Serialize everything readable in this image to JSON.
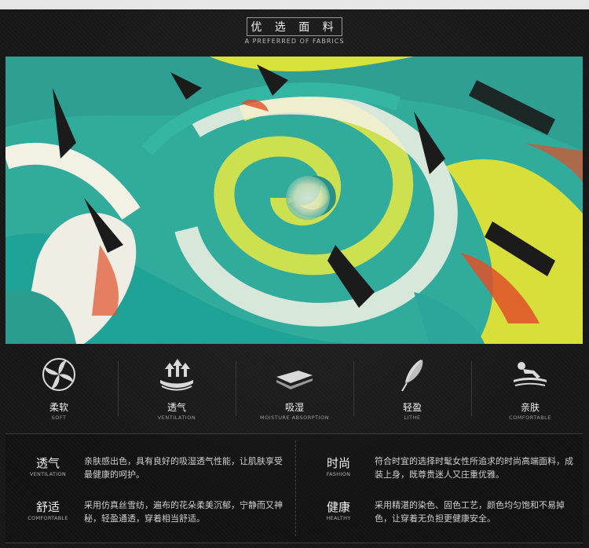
{
  "header": {
    "title": "优 选 面 料",
    "subtitle": "A PREFERRED OF FABRICS"
  },
  "photo": {
    "alt_colors": [
      "#2aa79a",
      "#d8e13a",
      "#f2f0e6",
      "#1a1a1a",
      "#e0502a"
    ]
  },
  "features": [
    {
      "icon": "pinwheel-icon",
      "label": "柔软",
      "sub": "SOFT"
    },
    {
      "icon": "breathable-arrows-icon",
      "label": "透气",
      "sub": "VENTILATION"
    },
    {
      "icon": "absorbent-layers-icon",
      "label": "吸湿",
      "sub": "MOISTURE ABSORPTION"
    },
    {
      "icon": "feather-icon",
      "label": "轻盈",
      "sub": "LITHE"
    },
    {
      "icon": "reclining-figure-icon",
      "label": "亲肤",
      "sub": "COMFORTABLE"
    }
  ],
  "details": [
    {
      "title": "透气",
      "sub": "VENTILATION",
      "text": "亲肤感出色，具有良好的吸湿透气性能，让肌肤享受最健康的呵护。"
    },
    {
      "title": "时尚",
      "sub": "FASHION",
      "text": "符合时宜的选择时髦女性所追求的时尚高端面料，成装上身，既尊贵迷人又庄重优雅。"
    },
    {
      "title": "舒适",
      "sub": "COMFORTABLE",
      "text": "采用仿真丝雪纺，遍布的花朵柔美沉郁，宁静而又神秘，轻盈通透，穿着相当舒适。"
    },
    {
      "title": "健康",
      "sub": "HEALTHY",
      "text": "采用精湛的染色、固色工艺，颜色均匀饱和不易掉色，让穿着无负担更健康安全。"
    }
  ]
}
